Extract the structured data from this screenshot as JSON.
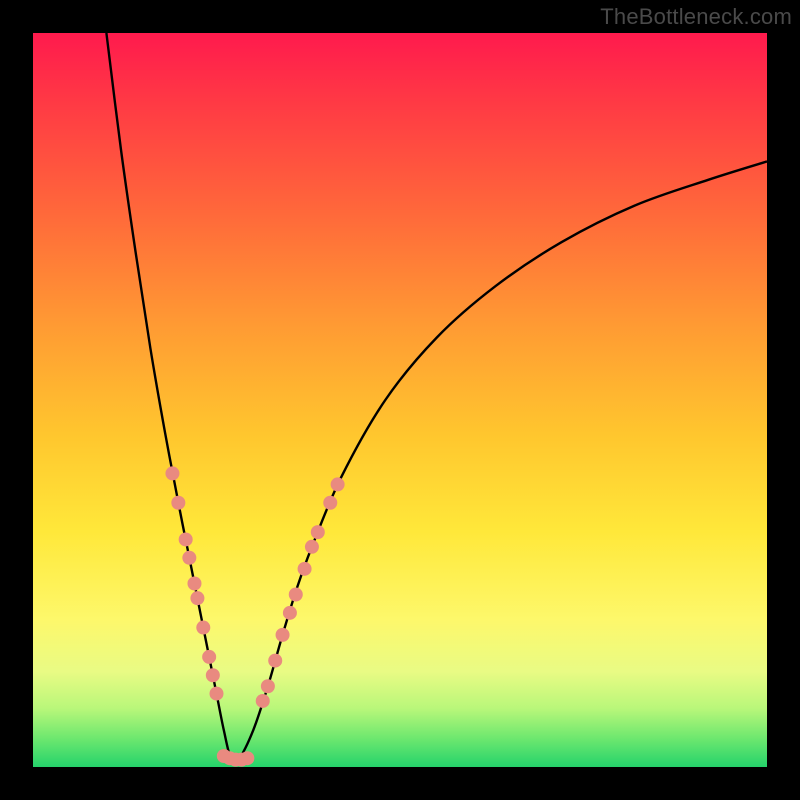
{
  "watermark": "TheBottleneck.com",
  "colors": {
    "curve_stroke": "#000000",
    "dot_fill": "#e98a80",
    "dot_stroke": "#c96f66"
  },
  "chart_data": {
    "type": "line",
    "title": "",
    "xlabel": "",
    "ylabel": "",
    "xlim": [
      0,
      100
    ],
    "ylim": [
      0,
      100
    ],
    "series": [
      {
        "name": "bottleneck-curve",
        "x": [
          10.0,
          12.0,
          14.0,
          16.0,
          18.0,
          20.0,
          21.0,
          22.0,
          23.0,
          24.0,
          25.0,
          26.0,
          27.0,
          28.0,
          30.0,
          32.0,
          34.0,
          36.0,
          38.0,
          42.0,
          48.0,
          55.0,
          63.0,
          72.0,
          82.0,
          92.0,
          100.0
        ],
        "y": [
          100.0,
          84.0,
          70.0,
          57.0,
          45.5,
          35.0,
          30.0,
          25.0,
          20.0,
          15.0,
          10.0,
          5.0,
          1.0,
          1.0,
          5.0,
          11.0,
          18.0,
          24.5,
          30.0,
          39.5,
          50.0,
          58.5,
          65.5,
          71.5,
          76.5,
          80.0,
          82.5
        ]
      }
    ],
    "dots": {
      "name": "highlight-dots",
      "points": [
        {
          "x": 19.0,
          "y": 40.0
        },
        {
          "x": 19.8,
          "y": 36.0
        },
        {
          "x": 20.8,
          "y": 31.0
        },
        {
          "x": 21.3,
          "y": 28.5
        },
        {
          "x": 22.0,
          "y": 25.0
        },
        {
          "x": 22.4,
          "y": 23.0
        },
        {
          "x": 23.2,
          "y": 19.0
        },
        {
          "x": 24.0,
          "y": 15.0
        },
        {
          "x": 24.5,
          "y": 12.5
        },
        {
          "x": 25.0,
          "y": 10.0
        },
        {
          "x": 26.0,
          "y": 1.5
        },
        {
          "x": 26.8,
          "y": 1.2
        },
        {
          "x": 27.6,
          "y": 1.0
        },
        {
          "x": 28.4,
          "y": 1.0
        },
        {
          "x": 29.2,
          "y": 1.2
        },
        {
          "x": 31.3,
          "y": 9.0
        },
        {
          "x": 32.0,
          "y": 11.0
        },
        {
          "x": 33.0,
          "y": 14.5
        },
        {
          "x": 34.0,
          "y": 18.0
        },
        {
          "x": 35.0,
          "y": 21.0
        },
        {
          "x": 35.8,
          "y": 23.5
        },
        {
          "x": 37.0,
          "y": 27.0
        },
        {
          "x": 38.0,
          "y": 30.0
        },
        {
          "x": 38.8,
          "y": 32.0
        },
        {
          "x": 40.5,
          "y": 36.0
        },
        {
          "x": 41.5,
          "y": 38.5
        }
      ]
    }
  }
}
